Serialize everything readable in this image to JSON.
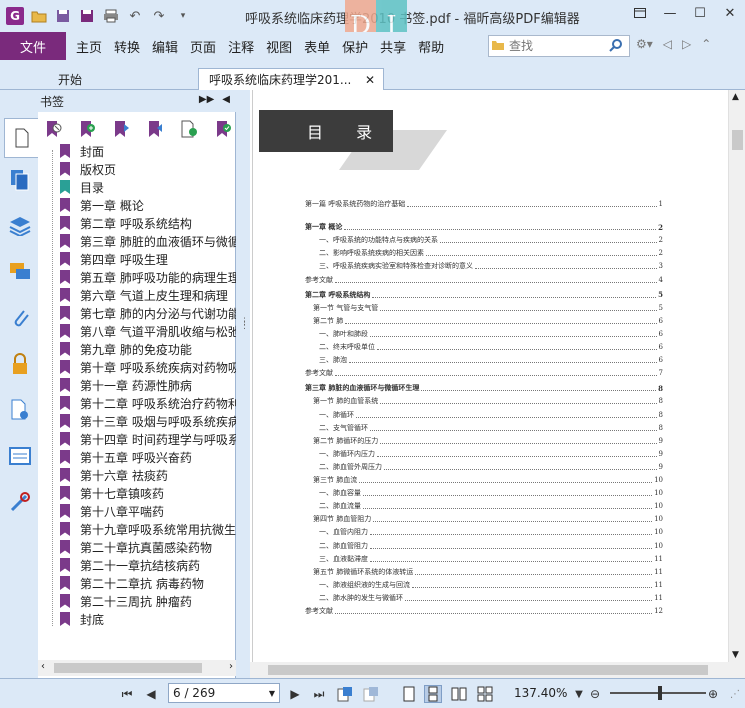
{
  "window": {
    "title": "呼吸系统临床药理学2010 书签.pdf - 福昕高级PDF编辑器",
    "overlay_left": "D",
    "overlay_right": "I"
  },
  "menu": {
    "file": "文件",
    "items": [
      "主页",
      "转换",
      "编辑",
      "页面",
      "注释",
      "视图",
      "表单",
      "保护",
      "共享",
      "帮助"
    ],
    "search_placeholder": "查找"
  },
  "tabs": {
    "home": "开始",
    "doc": "呼吸系统临床药理学201..."
  },
  "panel": {
    "title": "书签"
  },
  "bookmarks": [
    {
      "label": "封面",
      "color": "purple"
    },
    {
      "label": "版权页",
      "color": "purple"
    },
    {
      "label": "目录",
      "color": "teal"
    },
    {
      "label": "第一章 概论",
      "color": "purple"
    },
    {
      "label": "第二章 呼吸系统结构",
      "color": "purple"
    },
    {
      "label": "第三章 肺脏的血液循环与微循",
      "color": "purple"
    },
    {
      "label": "第四章 呼吸生理",
      "color": "purple"
    },
    {
      "label": "第五章 肺呼吸功能的病理生理",
      "color": "purple"
    },
    {
      "label": "第六章 气道上皮生理和病理",
      "color": "purple"
    },
    {
      "label": "第七章 肺的内分泌与代谢功能",
      "color": "purple"
    },
    {
      "label": "第八章 气道平滑肌收缩与松弛",
      "color": "purple"
    },
    {
      "label": "第九章 肺的免疫功能",
      "color": "purple"
    },
    {
      "label": "第十章 呼吸系统疾病对药物吸",
      "color": "purple"
    },
    {
      "label": "第十一章 药源性肺病",
      "color": "purple"
    },
    {
      "label": "第十二章 呼吸系统治疗药物利",
      "color": "purple"
    },
    {
      "label": "第十三章 吸烟与呼吸系统疾病",
      "color": "purple"
    },
    {
      "label": "第十四章 时间药理学与呼吸系",
      "color": "purple"
    },
    {
      "label": "第十五章 呼吸兴奋药",
      "color": "purple"
    },
    {
      "label": "第十六章 祛痰药",
      "color": "purple"
    },
    {
      "label": "第十七章镇咳药",
      "color": "purple"
    },
    {
      "label": "第十八章平喘药",
      "color": "purple"
    },
    {
      "label": "第十九章呼吸系统常用抗微生",
      "color": "purple"
    },
    {
      "label": "第二十章抗真菌感染药物",
      "color": "purple"
    },
    {
      "label": "第二十一章抗结核病药",
      "color": "purple"
    },
    {
      "label": "第二十二章抗 病毒药物",
      "color": "purple"
    },
    {
      "label": "第二十三周抗 肿瘤药",
      "color": "purple"
    },
    {
      "label": "封底",
      "color": "purple"
    }
  ],
  "toc": {
    "heading": "目 录",
    "rows": [
      {
        "t": "第一篇 呼吸系统药物的治疗基础",
        "p": "1",
        "bold": false
      },
      {
        "t": "第一章 概论",
        "p": "2",
        "bold": true
      },
      {
        "t": "一、呼吸系统的功能特点与疾病的关系",
        "p": "2",
        "bold": false
      },
      {
        "t": "二、影响呼吸系统疾病的相关因素",
        "p": "2",
        "bold": false
      },
      {
        "t": "三、呼吸系统疾病实验室和特殊检查对诊断的意义",
        "p": "3",
        "bold": false
      },
      {
        "t": "参考文献",
        "p": "4",
        "bold": false
      },
      {
        "t": "第二章 呼吸系统结构",
        "p": "5",
        "bold": true
      },
      {
        "t": "第一节 气管与支气管",
        "p": "5",
        "bold": false
      },
      {
        "t": "第二节 肺",
        "p": "6",
        "bold": false
      },
      {
        "t": "一、肺叶和肺段",
        "p": "6",
        "bold": false
      },
      {
        "t": "二、终末呼吸单位",
        "p": "6",
        "bold": false
      },
      {
        "t": "三、肺泡",
        "p": "6",
        "bold": false
      },
      {
        "t": "参考文献",
        "p": "7",
        "bold": false
      },
      {
        "t": "第三章 肺脏的血液循环与微循环生理",
        "p": "8",
        "bold": true
      },
      {
        "t": "第一节 肺的血管系统",
        "p": "8",
        "bold": false
      },
      {
        "t": "一、肺循环",
        "p": "8",
        "bold": false
      },
      {
        "t": "二、支气管循环",
        "p": "8",
        "bold": false
      },
      {
        "t": "第二节 肺循环的压力",
        "p": "9",
        "bold": false
      },
      {
        "t": "一、肺循环内压力",
        "p": "9",
        "bold": false
      },
      {
        "t": "二、肺血管外周压力",
        "p": "9",
        "bold": false
      },
      {
        "t": "第三节 肺血流",
        "p": "10",
        "bold": false
      },
      {
        "t": "一、肺血容量",
        "p": "10",
        "bold": false
      },
      {
        "t": "二、肺血流量",
        "p": "10",
        "bold": false
      },
      {
        "t": "第四节 肺血管阻力",
        "p": "10",
        "bold": false
      },
      {
        "t": "一、血管内阻力",
        "p": "10",
        "bold": false
      },
      {
        "t": "二、肺血管阻力",
        "p": "10",
        "bold": false
      },
      {
        "t": "三、血液黏滞度",
        "p": "11",
        "bold": false
      },
      {
        "t": "第五节 肺微循环系统的体液转运",
        "p": "11",
        "bold": false
      },
      {
        "t": "一、肺液组织液的生成与回流",
        "p": "11",
        "bold": false
      },
      {
        "t": "二、肺水肿的发生与微循环",
        "p": "11",
        "bold": false
      },
      {
        "t": "参考文献",
        "p": "12",
        "bold": false
      }
    ]
  },
  "status": {
    "page_value": "6 / 269",
    "zoom": "137.40%"
  },
  "colors": {
    "accent": "#7a2a7c",
    "chrome": "#dce9f7",
    "bookmark_purple": "#7b3a8a",
    "bookmark_teal": "#2aa096"
  }
}
